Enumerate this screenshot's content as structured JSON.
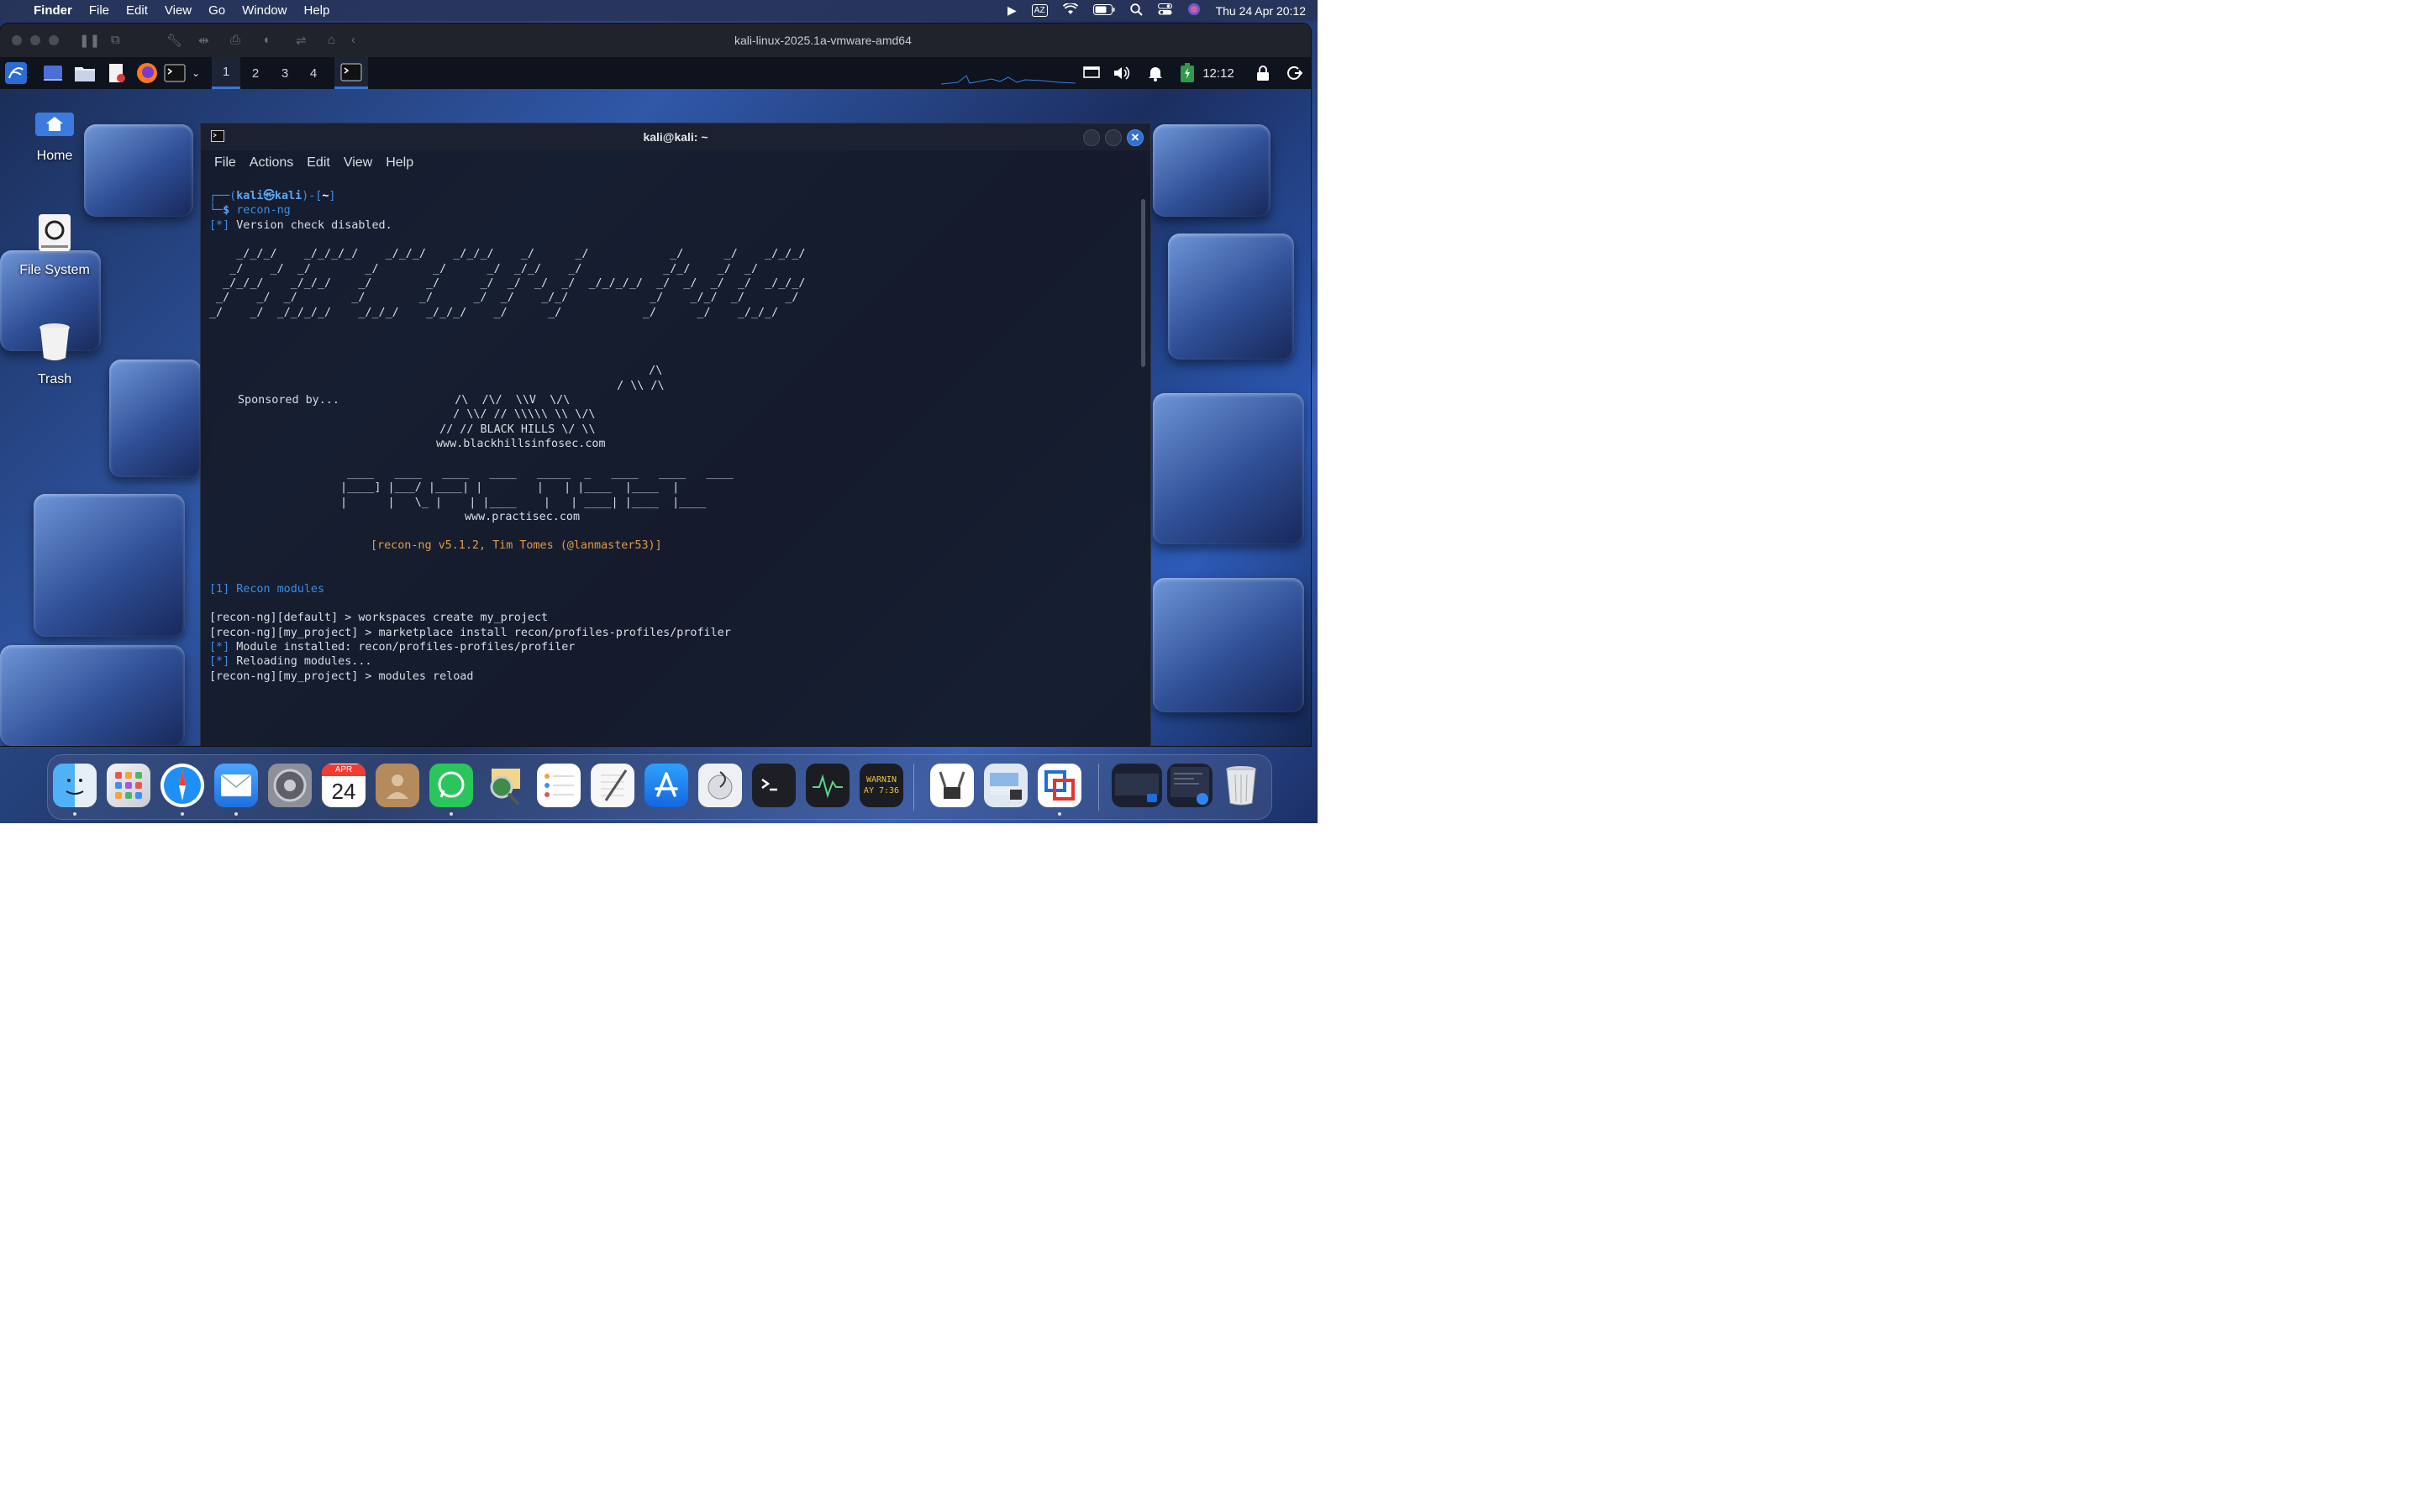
{
  "menubar": {
    "app": "Finder",
    "items": [
      "File",
      "Edit",
      "View",
      "Go",
      "Window",
      "Help"
    ],
    "input_source": "AZ",
    "datetime": "Thu 24 Apr  20:12"
  },
  "vmware": {
    "title": "kali-linux-2025.1a-vmware-amd64"
  },
  "xfce_panel": {
    "workspaces": [
      "1",
      "2",
      "3",
      "4"
    ],
    "active_workspace": "1",
    "clock": "12:12"
  },
  "desktop_icons": [
    {
      "label": "Home"
    },
    {
      "label": "File System"
    },
    {
      "label": "Trash"
    }
  ],
  "terminal": {
    "title": "kali@kali: ~",
    "menu": [
      "File",
      "Actions",
      "Edit",
      "View",
      "Help"
    ],
    "prompt_user": "kali",
    "prompt_host": "kali",
    "prompt_dir": "~",
    "command": "recon-ng",
    "line_version_check": "Version check disabled.",
    "banner": [
      "    _/_/_/    _/_/_/_/    _/_/_/    _/_/_/    _/      _/            _/      _/    _/_/_/",
      "   _/    _/  _/        _/        _/      _/  _/_/    _/            _/_/    _/  _/",
      "  _/_/_/    _/_/_/    _/        _/      _/  _/  _/  _/  _/_/_/_/  _/  _/  _/  _/  _/_/_/",
      " _/    _/  _/        _/        _/      _/  _/    _/_/            _/    _/_/  _/      _/",
      "_/    _/  _/_/_/_/    _/_/_/    _/_/_/    _/      _/            _/      _/    _/_/_/"
    ],
    "sponsored_by": "Sponsored by...",
    "bhis_art": [
      "                   /\\",
      "                  / \\\\ /\\",
      "    /\\  /\\/  \\\\V  \\/\\",
      "   / \\\\/ // \\\\\\\\\\ \\\\ \\/\\",
      "  // // BLACK HILLS \\/ \\\\"
    ],
    "bhis_url": "www.blackhillsinfosec.com",
    "practisec_art": [
      "  ____   ____   ____   ____   _____  _   ____   ____   ____",
      " |____] |___/ |____| |        |   | |____  |____  |",
      " |      |   \\_ |    | |____    |   | ____| |____  |____"
    ],
    "practisec_url": "www.practisec.com",
    "version_line": "[recon-ng v5.1.2, Tim Tomes (@lanmaster53)]",
    "modules_line": "[1] Recon modules",
    "session": [
      {
        "prompt": "[recon-ng][default] > ",
        "text": "workspaces create my_project"
      },
      {
        "prompt": "[recon-ng][my_project] > ",
        "text": "marketplace install recon/profiles-profiles/profiler"
      },
      {
        "prompt": "[*] ",
        "text": "Module installed: recon/profiles-profiles/profiler"
      },
      {
        "prompt": "[*] ",
        "text": "Reloading modules..."
      },
      {
        "prompt": "[recon-ng][my_project] > ",
        "text": "modules reload"
      }
    ]
  },
  "dock": {
    "calendar_month": "APR",
    "calendar_day": "24",
    "console_text_1": "WARNIN",
    "console_text_2": "AY 7:36"
  }
}
